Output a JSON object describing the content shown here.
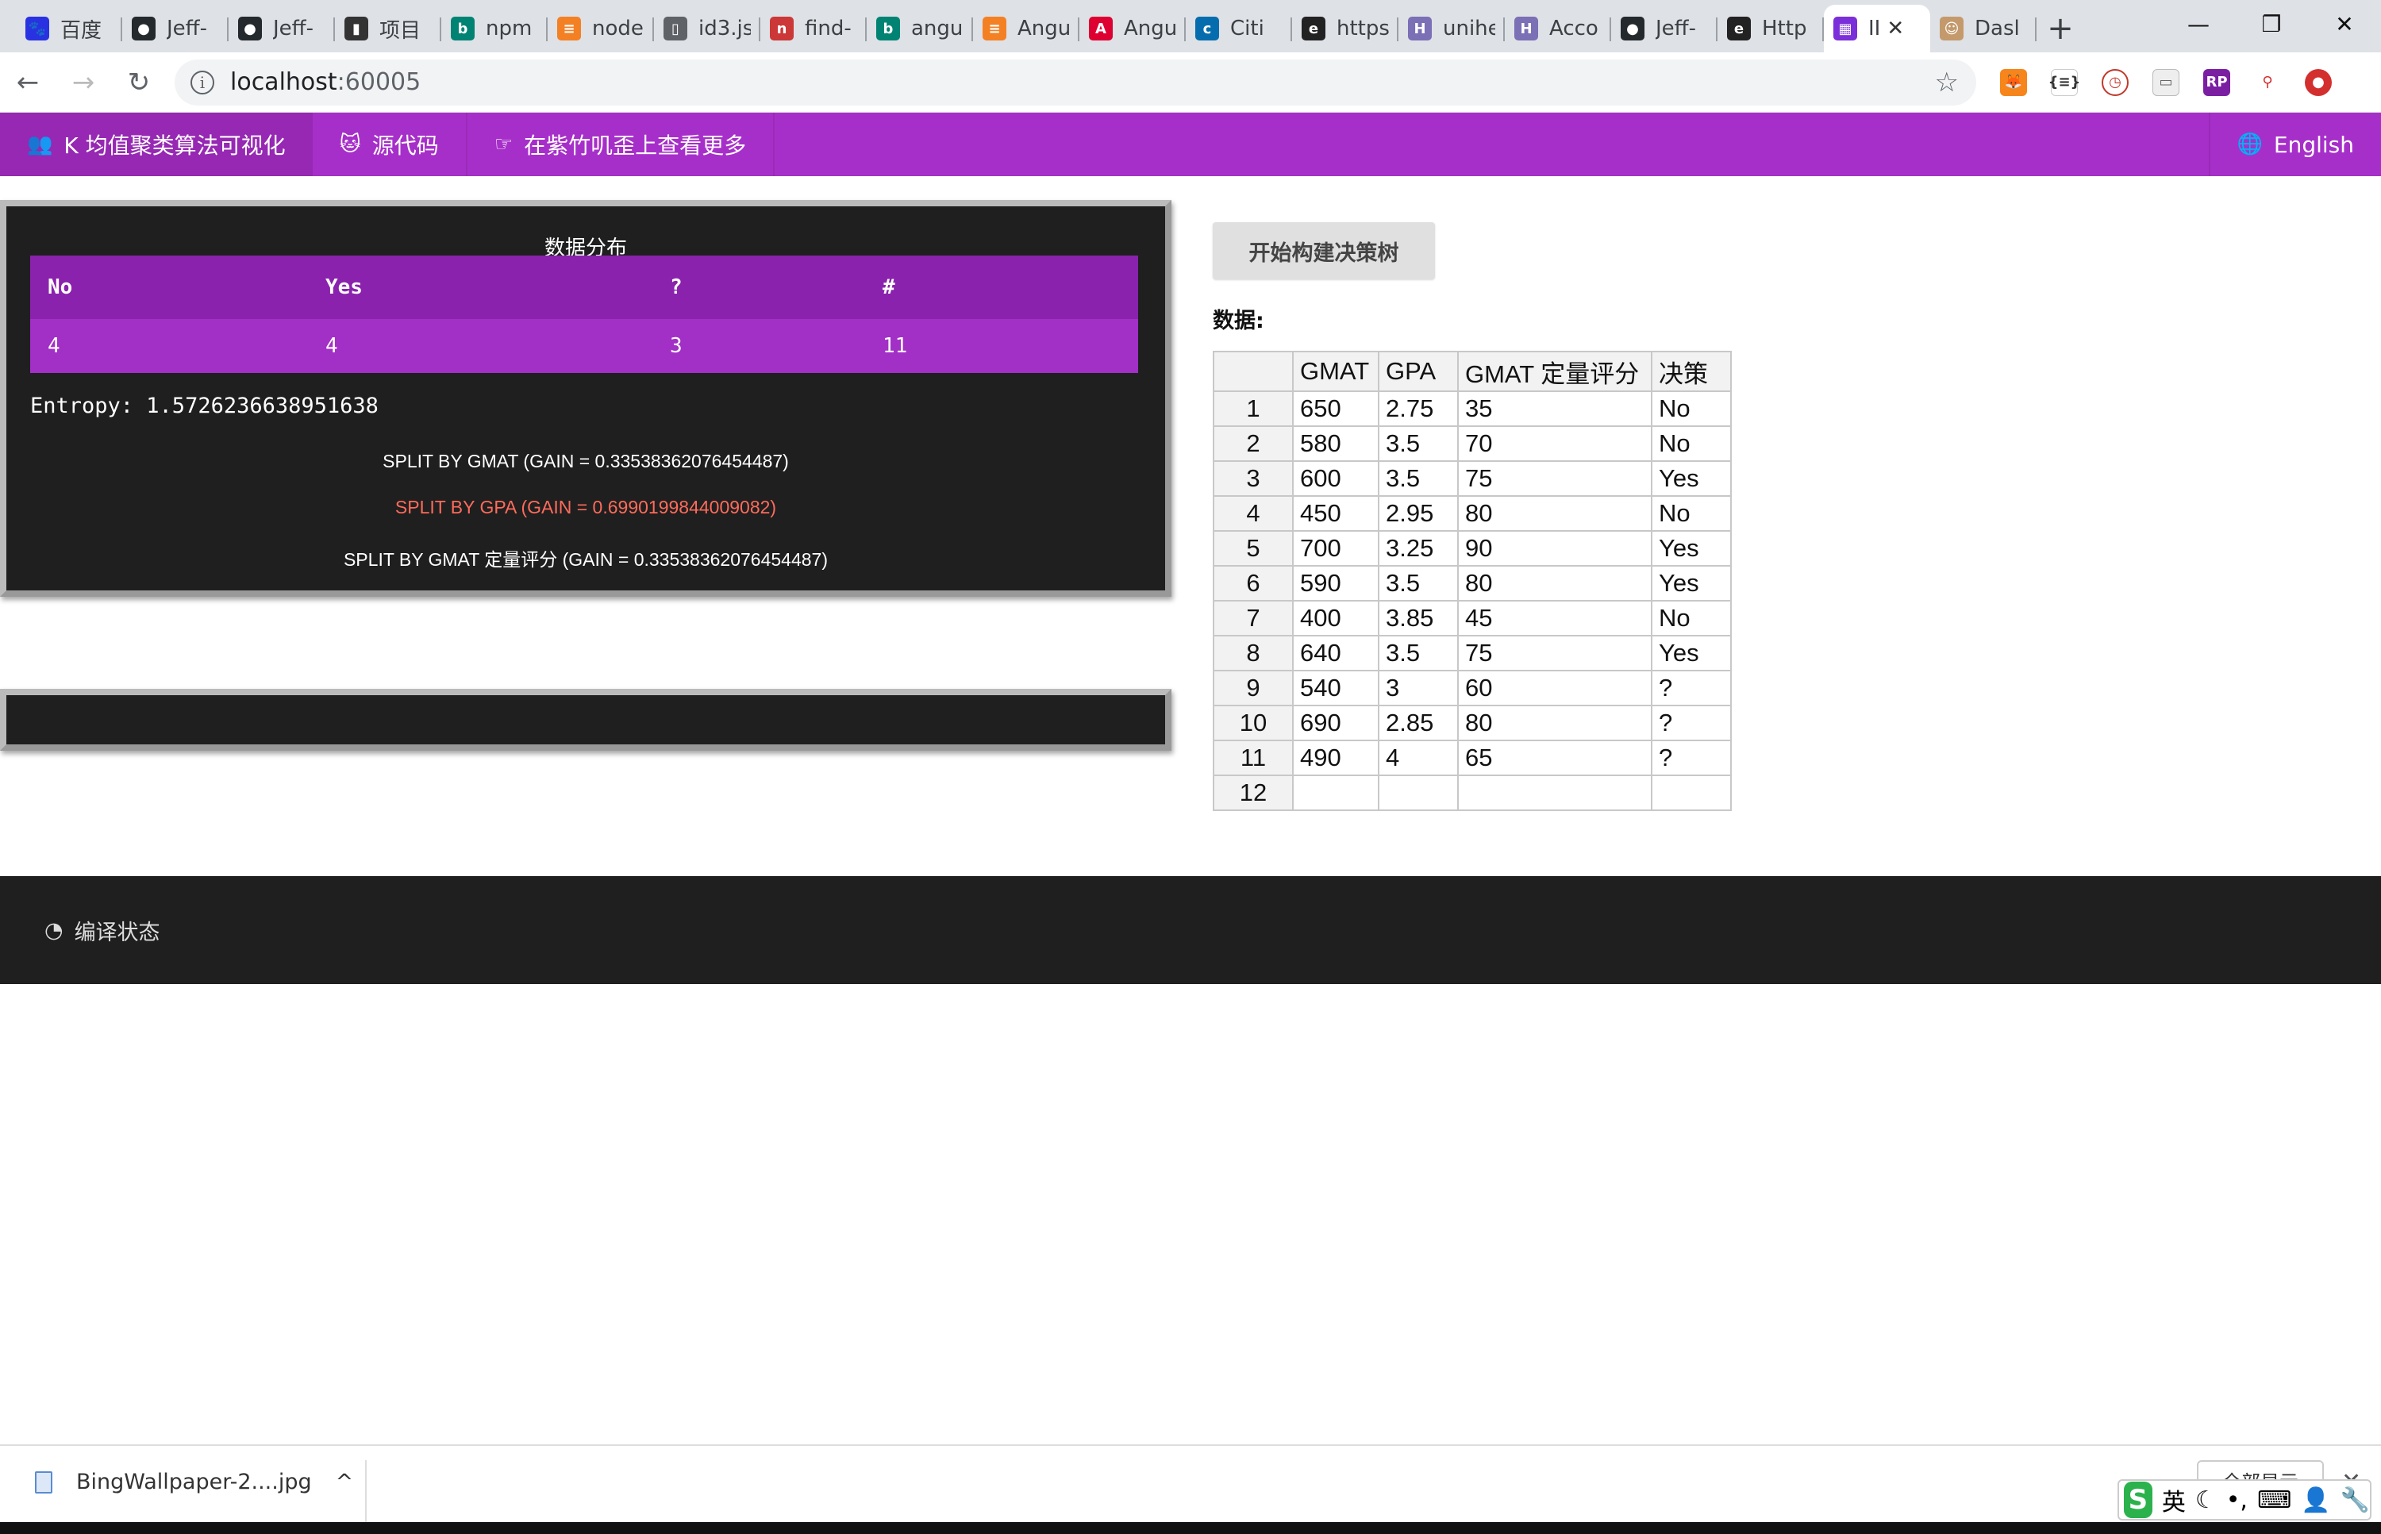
{
  "browser": {
    "tabs": [
      {
        "title": "百度",
        "icon": "baidu-icon",
        "color": "#2932e1"
      },
      {
        "title": "Jeff-",
        "icon": "github-icon",
        "color": "#24292e"
      },
      {
        "title": "Jeff-",
        "icon": "github-icon",
        "color": "#24292e"
      },
      {
        "title": "项目",
        "icon": "book-icon",
        "color": "#333333"
      },
      {
        "title": "npm",
        "icon": "bing-icon",
        "color": "#008373"
      },
      {
        "title": "node",
        "icon": "stackoverflow-icon",
        "color": "#f48024"
      },
      {
        "title": "id3.js",
        "icon": "file-icon",
        "color": "#5f6368"
      },
      {
        "title": "find-",
        "icon": "npm-icon",
        "color": "#cb3837"
      },
      {
        "title": "angu",
        "icon": "bing-icon",
        "color": "#008373"
      },
      {
        "title": "Angu",
        "icon": "stackoverflow-icon",
        "color": "#f48024"
      },
      {
        "title": "Angu",
        "icon": "angular-icon",
        "color": "#dd0031"
      },
      {
        "title": "Citi",
        "icon": "citi-icon",
        "color": "#056dae"
      },
      {
        "title": "https",
        "icon": "edge-icon",
        "color": "#222222"
      },
      {
        "title": "unihe",
        "icon": "hexo-icon",
        "color": "#7b6fb5"
      },
      {
        "title": "Acco",
        "icon": "hexo-icon",
        "color": "#7b6fb5"
      },
      {
        "title": "Jeff-",
        "icon": "github-icon",
        "color": "#24292e"
      },
      {
        "title": "Http",
        "icon": "edge-icon",
        "color": "#222222"
      },
      {
        "title": "II",
        "icon": "app-logo-icon",
        "color": "#7b2fd9",
        "active": true
      },
      {
        "title": "Dasl",
        "icon": "avatar-icon",
        "color": "#c49a6c"
      }
    ],
    "new_tab": "+",
    "window_controls": {
      "minimize": "—",
      "restore": "❐",
      "close": "✕"
    },
    "url_host": "localhost",
    "url_port": ":60005"
  },
  "nav": {
    "brand": "K 均值聚类算法可视化",
    "source": "源代码",
    "more": "在紫竹叽歪上查看更多",
    "language": "English"
  },
  "distribution": {
    "title": "数据分布",
    "headers": [
      "No",
      "Yes",
      "?",
      "#"
    ],
    "values": [
      "4",
      "4",
      "3",
      "11"
    ],
    "entropy": "Entropy: 1.5726236638951638",
    "splits": [
      {
        "text": "SPLIT BY GMAT (GAIN = 0.33538362076454487)",
        "highlight": false
      },
      {
        "text": "SPLIT BY GPA (GAIN = 0.6990199844009082)",
        "highlight": true
      },
      {
        "text": "SPLIT BY GMAT 定量评分 (GAIN = 0.33538362076454487)",
        "highlight": false
      }
    ],
    "highlight_color": "#ff6b5b"
  },
  "controls": {
    "build_button": "开始构建决策树",
    "data_label": "数据:"
  },
  "data_table": {
    "headers": [
      "",
      "GMAT",
      "GPA",
      "GMAT 定量评分",
      "决策"
    ],
    "rows": [
      [
        "1",
        "650",
        "2.75",
        "35",
        "No"
      ],
      [
        "2",
        "580",
        "3.5",
        "70",
        "No"
      ],
      [
        "3",
        "600",
        "3.5",
        "75",
        "Yes"
      ],
      [
        "4",
        "450",
        "2.95",
        "80",
        "No"
      ],
      [
        "5",
        "700",
        "3.25",
        "90",
        "Yes"
      ],
      [
        "6",
        "590",
        "3.5",
        "80",
        "Yes"
      ],
      [
        "7",
        "400",
        "3.85",
        "45",
        "No"
      ],
      [
        "8",
        "640",
        "3.5",
        "75",
        "Yes"
      ],
      [
        "9",
        "540",
        "3",
        "60",
        "?"
      ],
      [
        "10",
        "690",
        "2.85",
        "80",
        "?"
      ],
      [
        "11",
        "490",
        "4",
        "65",
        "?"
      ],
      [
        "12",
        "",
        "",
        "",
        ""
      ]
    ]
  },
  "footer": {
    "status": "编译状态"
  },
  "downloads": {
    "file": "BingWallpaper-2....jpg",
    "show_all": "全部显示"
  },
  "ime": {
    "logo": "S",
    "lang": "英"
  }
}
